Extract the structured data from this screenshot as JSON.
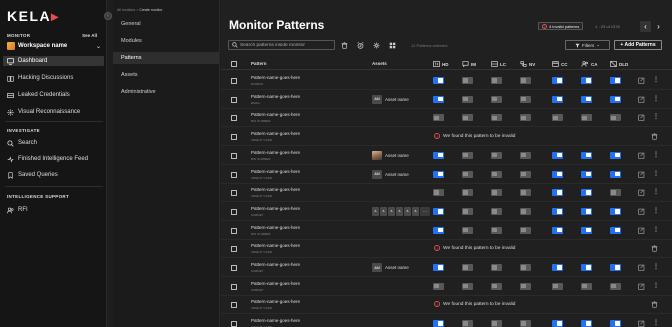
{
  "sidebar": {
    "logo": "KELA",
    "monitor_label": "MONITOR",
    "see_all": "See All",
    "workspace_name": "Workspace name",
    "nav_items": [
      {
        "label": "Dashboard",
        "icon": "monitor-icon",
        "active": true
      },
      {
        "label": "Hacking Discussions",
        "icon": "book-icon"
      },
      {
        "label": "Leaked Credentials",
        "icon": "credential-card-icon"
      },
      {
        "label": "Visual Reconnaissance",
        "icon": "radar-icon"
      }
    ],
    "investigate_label": "INVESTIGATE",
    "investigate_items": [
      {
        "label": "Search",
        "icon": "search-icon"
      },
      {
        "label": "Finished Intelligence Feed",
        "icon": "feed-icon"
      },
      {
        "label": "Saved Queries",
        "icon": "bookmark-icon"
      }
    ],
    "support_label": "INTELLIGENCE SUPPORT",
    "support_items": [
      {
        "label": "RFI",
        "icon": "users-icon"
      }
    ]
  },
  "subnav": {
    "breadcrumb_root": "All monitors",
    "breadcrumb_sep": ">",
    "breadcrumb_current": "Create monitor",
    "items": [
      {
        "label": "General"
      },
      {
        "label": "Modules"
      },
      {
        "label": "Patterns",
        "active": true
      },
      {
        "label": "Assets"
      },
      {
        "label": "Administrative"
      }
    ]
  },
  "page": {
    "title": "Monitor Patterns",
    "invalid_badge": "4 invalid patterns",
    "pagination": "1 - 23 of 1376",
    "search_placeholder": "Search patterns inside monitor",
    "selected_text": "12 Patterns selected",
    "filters_label": "Filters",
    "add_label": "+ Add Patterns"
  },
  "table": {
    "columns": {
      "pattern": "Pattern",
      "assets": "Assets",
      "hd": "HD",
      "im": "IM",
      "lc": "LC",
      "nv": "NV",
      "cc": "CC",
      "ca": "CA",
      "dld": "DLD"
    },
    "invalid_message": "We found this pattern to be invalid",
    "rows": [
      {
        "name": "Pattern-name-goes-here",
        "type": "DOMAIN",
        "asset": null,
        "toggles": [
          1,
          0,
          0,
          0,
          1,
          1,
          1
        ]
      },
      {
        "name": "Pattern-name-goes-here",
        "type": "EMAIL",
        "asset": {
          "kind": "initials",
          "initials": "AN",
          "label": "Asset name"
        },
        "toggles": [
          1,
          0,
          0,
          0,
          1,
          1,
          1
        ]
      },
      {
        "name": "Pattern-name-goes-here",
        "type": "BIN NUMBER",
        "asset": null,
        "toggles": [
          0,
          0,
          0,
          0,
          0,
          0,
          0
        ]
      },
      {
        "name": "Pattern-name-goes-here",
        "type": "CREDIT CARD",
        "invalid": true
      },
      {
        "name": "Pattern-name-goes-here",
        "type": "BIN NUMBER",
        "asset": {
          "kind": "photo",
          "label": "Asset name"
        },
        "toggles": [
          1,
          0,
          0,
          0,
          1,
          1,
          1
        ]
      },
      {
        "name": "Pattern-name-goes-here",
        "type": "CREDIT CARD",
        "asset": {
          "kind": "initials",
          "initials": "AN",
          "label": "Asset name"
        },
        "toggles": [
          1,
          0,
          0,
          0,
          1,
          1,
          1
        ]
      },
      {
        "name": "Pattern-name-goes-here",
        "type": "CREDIT CARD",
        "asset": null,
        "toggles": [
          0,
          0,
          0,
          0,
          1,
          1,
          0
        ]
      },
      {
        "name": "Pattern-name-goes-here",
        "type": "SUBNET",
        "asset": {
          "kind": "stack",
          "initials": [
            "A",
            "A",
            "A",
            "A",
            "A",
            "A"
          ],
          "more": "···"
        },
        "toggles": [
          1,
          0,
          0,
          0,
          1,
          1,
          1
        ]
      },
      {
        "name": "Pattern-name-goes-here",
        "type": "BIN NUMBER",
        "asset": null,
        "toggles": [
          1,
          0,
          0,
          0,
          1,
          1,
          1
        ]
      },
      {
        "name": "Pattern-name-goes-here",
        "type": "CREDIT CARD",
        "invalid": true
      },
      {
        "name": "Pattern-name-goes-here",
        "type": "SUBNET",
        "asset": {
          "kind": "initials",
          "initials": "AN",
          "label": "Asset name"
        },
        "toggles": [
          1,
          0,
          0,
          0,
          1,
          1,
          1
        ]
      },
      {
        "name": "Pattern-name-goes-here",
        "type": "SUBNET",
        "asset": null,
        "toggles": [
          0,
          0,
          0,
          0,
          0,
          0,
          0
        ]
      },
      {
        "name": "Pattern-name-goes-here",
        "type": "CREDIT CARD",
        "invalid": true
      },
      {
        "name": "Pattern-name-goes-here",
        "type": "CREDIT CARD",
        "asset": null,
        "toggles": [
          1,
          0,
          0,
          0,
          1,
          1,
          1
        ]
      }
    ]
  },
  "colors": {
    "accent": "#2370f0",
    "error": "#e05050",
    "background": "#202020",
    "sidebar": "#151515"
  }
}
